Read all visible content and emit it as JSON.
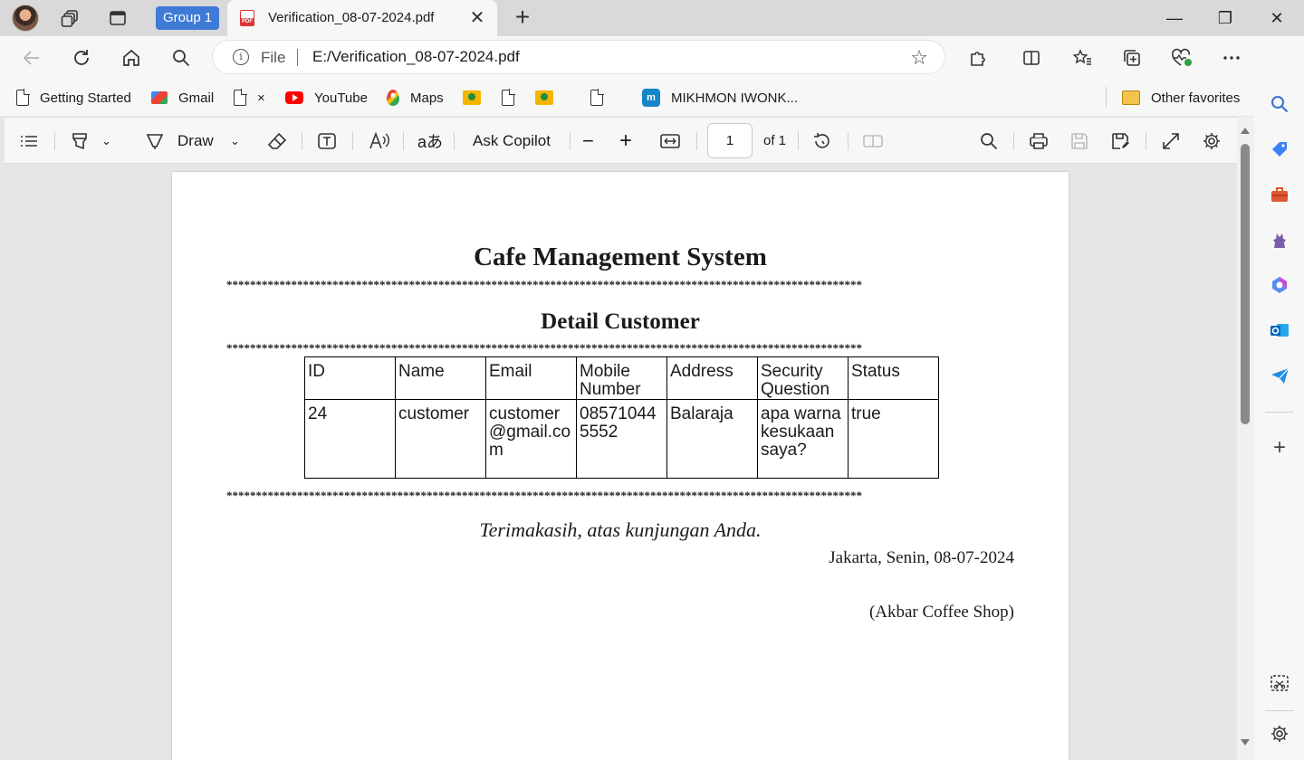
{
  "tabbar": {
    "group_label": "Group 1",
    "tab_title": "Verification_08-07-2024.pdf",
    "tab_close": "✕",
    "new_tab": "+",
    "window": {
      "minimize": "—",
      "maximize": "❐",
      "close": "✕"
    }
  },
  "address": {
    "scheme": "File",
    "url": "E:/Verification_08-07-2024.pdf"
  },
  "bookmarks": [
    {
      "label": "Getting Started",
      "icon": "doc-icon"
    },
    {
      "label": "Gmail",
      "icon": "gmail-icon"
    },
    {
      "label": "×",
      "icon": "doc-icon"
    },
    {
      "label": "YouTube",
      "icon": "youtube-icon"
    },
    {
      "label": "Maps",
      "icon": "maps-icon"
    },
    {
      "label": "",
      "icon": "classroom-icon"
    },
    {
      "label": "",
      "icon": "doc-icon"
    },
    {
      "label": "",
      "icon": "classroom-icon"
    },
    {
      "label": "",
      "icon": "doc-icon"
    },
    {
      "label": "MIKHMON IWONK...",
      "icon": "mikhmon-icon"
    }
  ],
  "other_favorites": "Other favorites",
  "pdf_toolbar": {
    "draw_label": "Draw",
    "ask_copilot": "Ask Copilot",
    "page_number": "1",
    "of_pages": "of 1"
  },
  "document": {
    "title": "Cafe Management System",
    "stars": "************************************************************************************************************",
    "subtitle": "Detail Customer",
    "table": {
      "headers": [
        "ID",
        "Name",
        "Email",
        "Mobile Number",
        "Address",
        "Security Question",
        "Status"
      ],
      "rows": [
        [
          "24",
          "customer",
          "customer@gmail.com",
          "085710445552",
          "Balaraja",
          "apa warna kesukaan saya?",
          "true"
        ]
      ]
    },
    "thanks": "Terimakasih, atas kunjungan Anda.",
    "place_date": "Jakarta, Senin, 08-07-2024",
    "shop": "(Akbar Coffee Shop)"
  },
  "colors": {
    "group_chip": "#3e7ad6",
    "pdf_icon": "#dd3333",
    "page_bg": "#ffffff",
    "viewer_bg": "#e6e6e6"
  }
}
